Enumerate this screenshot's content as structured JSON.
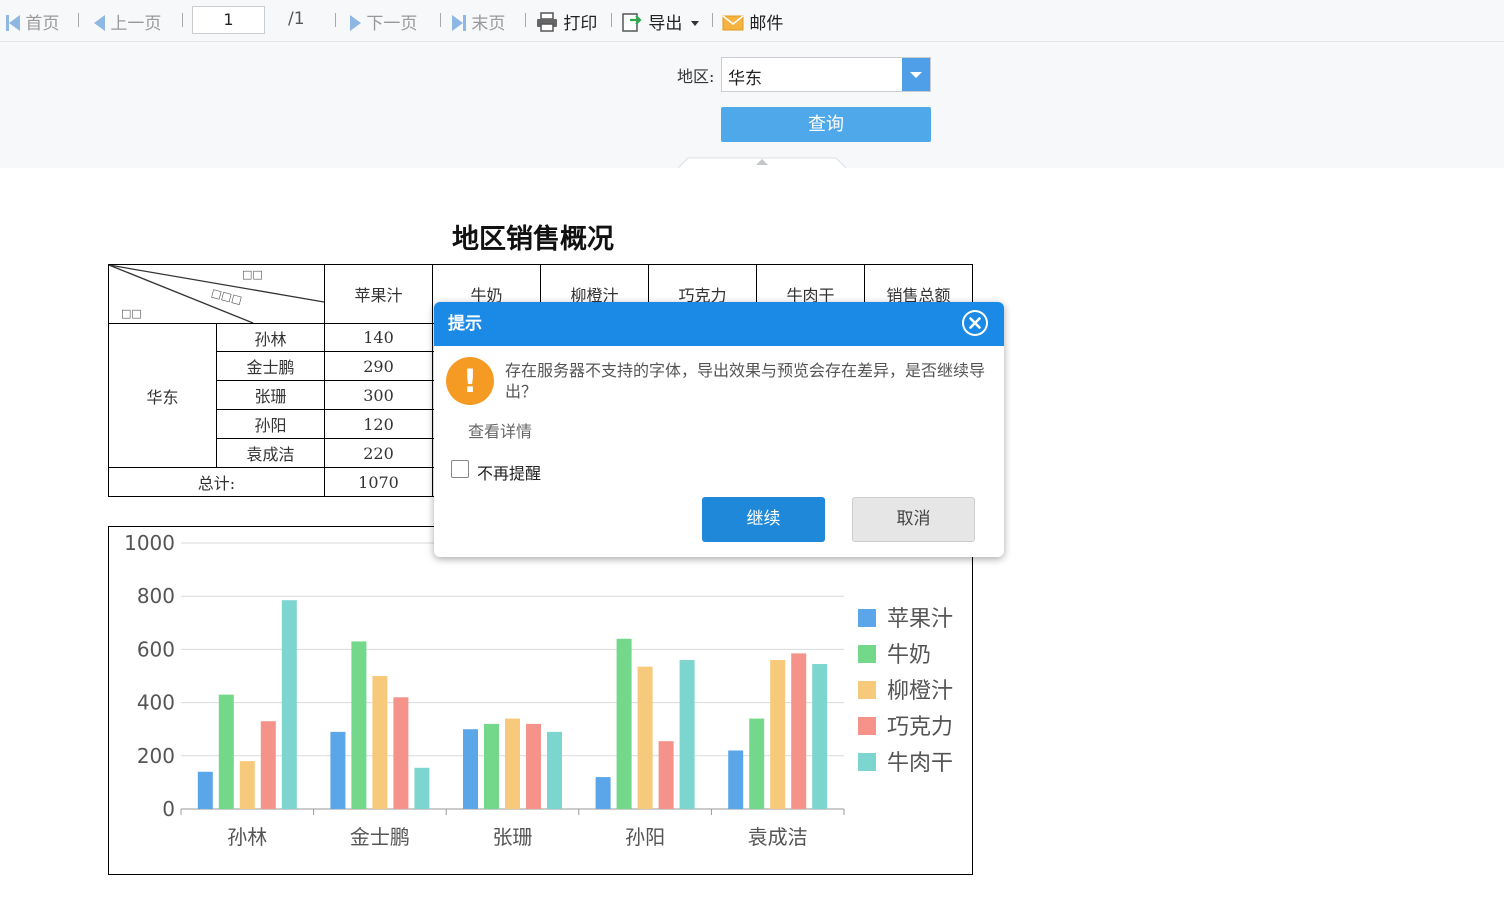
{
  "toolbar": {
    "first": "首页",
    "prev": "上一页",
    "page_value": "1",
    "page_total": "/1",
    "next": "下一页",
    "last": "末页",
    "print": "打印",
    "export": "导出",
    "mail": "邮件"
  },
  "params": {
    "region_label": "地区:",
    "region_value": "华东",
    "query_label": "查询"
  },
  "report": {
    "title": "地区销售概况",
    "header_corner": [
      "□□",
      "□□□",
      "□□"
    ],
    "columns": [
      "苹果汁",
      "牛奶",
      "柳橙汁",
      "巧克力",
      "牛肉干",
      "销售总额"
    ],
    "region": "华东",
    "rows": [
      {
        "name": "孙林",
        "apple": "140"
      },
      {
        "name": "金士鹏",
        "apple": "290"
      },
      {
        "name": "张珊",
        "apple": "300"
      },
      {
        "name": "孙阳",
        "apple": "120"
      },
      {
        "name": "袁成洁",
        "apple": "220"
      }
    ],
    "total_label": "总计:",
    "total_apple": "1070"
  },
  "chart_data": {
    "type": "bar",
    "categories": [
      "孙林",
      "金士鹏",
      "张珊",
      "孙阳",
      "袁成洁"
    ],
    "series": [
      {
        "name": "苹果汁",
        "color": "#5ba6e8",
        "values": [
          140,
          290,
          300,
          120,
          220
        ]
      },
      {
        "name": "牛奶",
        "color": "#73d88a",
        "values": [
          430,
          630,
          320,
          640,
          340
        ]
      },
      {
        "name": "柳橙汁",
        "color": "#f7c97a",
        "values": [
          180,
          500,
          340,
          535,
          560
        ]
      },
      {
        "name": "巧克力",
        "color": "#f5938a",
        "values": [
          330,
          420,
          320,
          255,
          585
        ]
      },
      {
        "name": "牛肉干",
        "color": "#7dd5cf",
        "values": [
          785,
          155,
          290,
          560,
          545
        ]
      }
    ],
    "ylim": [
      0,
      1000
    ],
    "yticks": [
      0,
      200,
      400,
      600,
      800,
      1000
    ],
    "grid": true,
    "legend": "right"
  },
  "dialog": {
    "title": "提示",
    "message": "存在服务器不支持的字体，导出效果与预览会存在差异，是否继续导出？",
    "detail_link": "查看详情",
    "checkbox_label": "不再提醒",
    "continue_label": "继续",
    "cancel_label": "取消"
  }
}
